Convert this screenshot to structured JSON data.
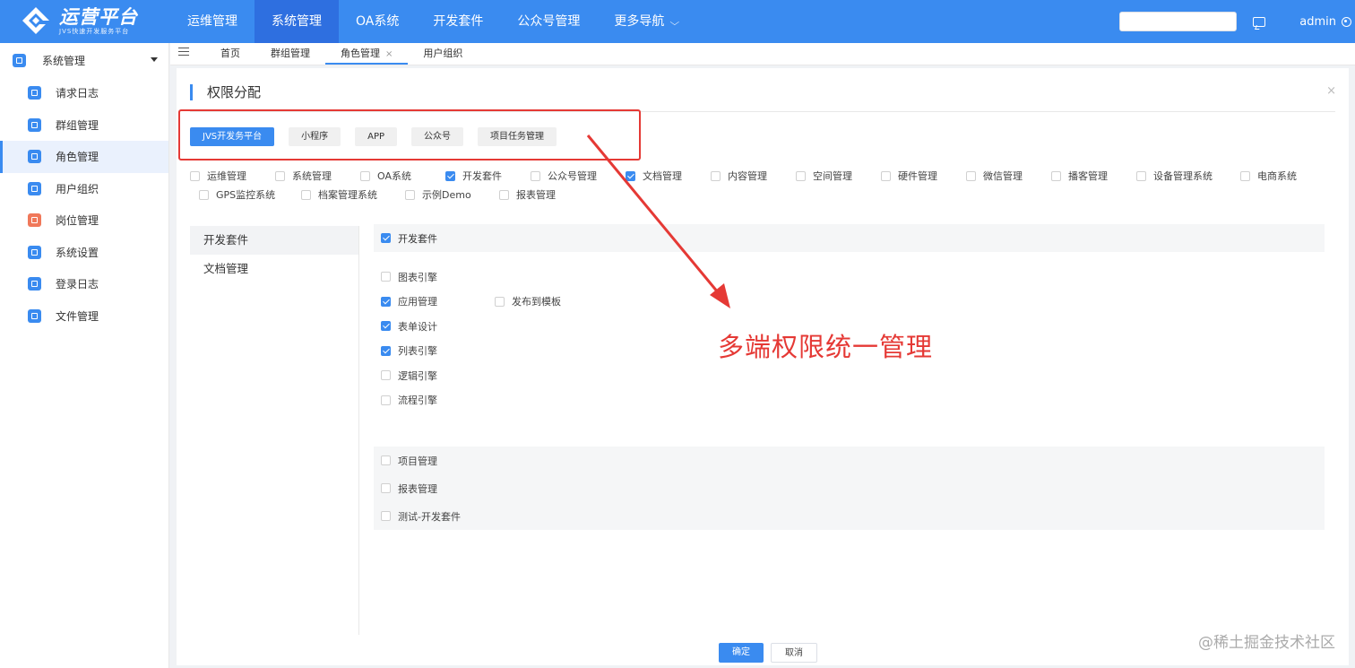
{
  "header": {
    "logo_title": "运营平台",
    "logo_subtitle": "JVS快速开发服务平台",
    "nav": [
      "运维管理",
      "系统管理",
      "OA系统",
      "开发套件",
      "公众号管理",
      "更多导航"
    ],
    "active_nav_index": 1,
    "user": "admin"
  },
  "sidebar": {
    "group": "系统管理",
    "items": [
      "请求日志",
      "群组管理",
      "角色管理",
      "用户组织",
      "岗位管理",
      "系统设置",
      "登录日志",
      "文件管理"
    ],
    "active_index": 2
  },
  "tabs": [
    {
      "label": "首页"
    },
    {
      "label": "群组管理"
    },
    {
      "label": "角色管理",
      "closable": true,
      "active": true
    },
    {
      "label": "用户组织"
    }
  ],
  "panel": {
    "title": "权限分配",
    "close": "×"
  },
  "platforms": [
    "JVS开发务平台",
    "小程序",
    "APP",
    "公众号",
    "项目任务管理"
  ],
  "active_platform_index": 0,
  "modules": [
    {
      "label": "运维管理",
      "checked": false
    },
    {
      "label": "系统管理",
      "checked": false
    },
    {
      "label": "OA系统",
      "checked": false
    },
    {
      "label": "开发套件",
      "checked": true
    },
    {
      "label": "公众号管理",
      "checked": false
    },
    {
      "label": "文档管理",
      "checked": true
    },
    {
      "label": "内容管理",
      "checked": false
    },
    {
      "label": "空间管理",
      "checked": false
    },
    {
      "label": "硬件管理",
      "checked": false
    },
    {
      "label": "微信管理",
      "checked": false
    },
    {
      "label": "播客管理",
      "checked": false
    },
    {
      "label": "设备管理系统",
      "checked": false
    },
    {
      "label": "电商系统",
      "checked": false
    },
    {
      "label": "GPS监控系统",
      "checked": false
    },
    {
      "label": "档案管理系统",
      "checked": false
    },
    {
      "label": "示例Demo",
      "checked": false
    },
    {
      "label": "报表管理",
      "checked": false
    }
  ],
  "left_list": [
    "开发套件",
    "文档管理"
  ],
  "section1": {
    "head": "开发套件",
    "head_checked": true,
    "perms": [
      {
        "label": "图表引擎",
        "checked": false
      },
      {
        "label": "应用管理",
        "checked": true,
        "sub": {
          "label": "发布到模板",
          "checked": false
        }
      },
      {
        "label": "表单设计",
        "checked": true
      },
      {
        "label": "列表引擎",
        "checked": true
      },
      {
        "label": "逻辑引擎",
        "checked": false
      },
      {
        "label": "流程引擎",
        "checked": false
      }
    ]
  },
  "section2": [
    {
      "label": "项目管理",
      "checked": false
    },
    {
      "label": "报表管理",
      "checked": false
    },
    {
      "label": "测试-开发套件",
      "checked": false
    }
  ],
  "buttons": {
    "confirm": "确定",
    "cancel": "取消"
  },
  "annotation": "多端权限统一管理",
  "watermark": "@稀土掘金技术社区",
  "colors": {
    "brand": "#3a8bf0",
    "annotation": "#e53935"
  }
}
